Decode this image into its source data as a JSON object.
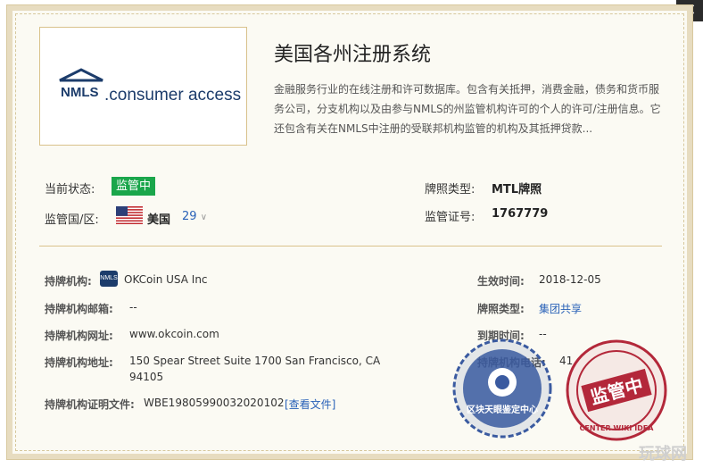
{
  "close": {
    "label": "×"
  },
  "logo": {
    "mark_text": "NMLS",
    "text": ".consumer access"
  },
  "registry": {
    "title": "美国各州注册系统",
    "description": "金融服务行业的在线注册和许可数据库。包含有关抵押，消费金融，债务和货币服务公司，分支机构以及由参与NMLS的州监管机构许可的个人的许可/注册信息。它还包含有关在NMLS中注册的受联邦机构监管的机构及其抵押贷款..."
  },
  "status": {
    "label": "当前状态:",
    "value": "监管中"
  },
  "region": {
    "label": "监管国/区:",
    "country": "美国",
    "count": "29"
  },
  "license_type": {
    "label": "牌照类型:",
    "value": "MTL牌照"
  },
  "license_no": {
    "label": "监管证号:",
    "value": "1767779"
  },
  "details": {
    "holder": {
      "label": "持牌机构:",
      "value": "OKCoin USA Inc",
      "icon_text": "NMLS"
    },
    "email": {
      "label": "持牌机构邮箱:",
      "value": "--"
    },
    "website": {
      "label": "持牌机构网址:",
      "value": "www.okcoin.com"
    },
    "address": {
      "label": "持牌机构地址:",
      "value_line1": "150 Spear Street Suite 1700 San Francisco, CA",
      "value_line2": "94105"
    },
    "cert_file": {
      "label": "持牌机构证明文件:",
      "value": "WBE19805990032020102",
      "link": "[查看文件]"
    },
    "effective": {
      "label": "生效时间:",
      "value": "2018-12-05"
    },
    "kind": {
      "label": "牌照类型:",
      "value": "集团共享"
    },
    "expiry": {
      "label": "到期时间:",
      "value": "--"
    },
    "phone": {
      "label": "持牌机构电话:",
      "value": "41"
    }
  },
  "seals": {
    "blue_text": "区块天眼鉴定中心",
    "red_text": "监管中",
    "red_ring": "CENTER WIKI IDEA"
  },
  "watermark": "玩球网",
  "colors": {
    "badge": "#1aa64b",
    "link": "#2a62b8",
    "seal_red": "#b3283a",
    "seal_blue": "#3a5aa0"
  }
}
